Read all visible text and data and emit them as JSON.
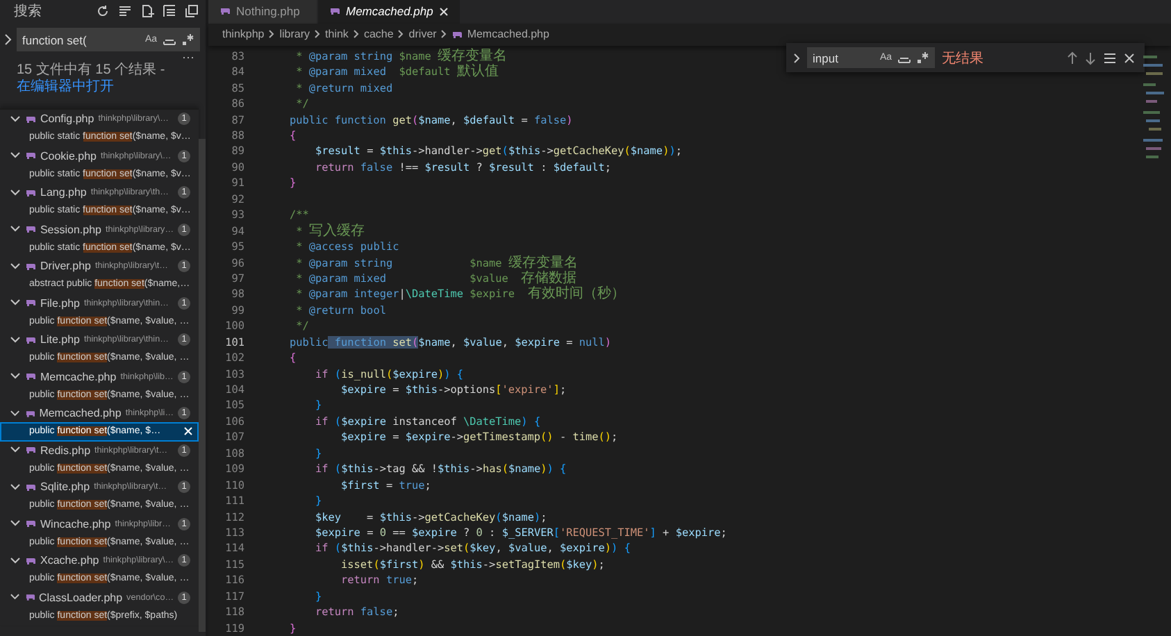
{
  "sidebar": {
    "title": "搜索",
    "search": {
      "value": "function set(",
      "case_label": "Aa"
    },
    "more": "···",
    "message": "15 文件中有 15 个结果 - ",
    "message_link": "在编辑器中打开",
    "results": [
      {
        "file": "Config.php",
        "path": "thinkphp\\library\\…",
        "count": "1",
        "expanded": true,
        "matches": [
          {
            "prefix": "public static ",
            "hit": "function set",
            "rest": "($name, $v…",
            "selected": false
          }
        ]
      },
      {
        "file": "Cookie.php",
        "path": "thinkphp\\library\\…",
        "count": "1",
        "expanded": true,
        "matches": [
          {
            "prefix": "public static ",
            "hit": "function set",
            "rest": "($name, $v…",
            "selected": false
          }
        ]
      },
      {
        "file": "Lang.php",
        "path": "thinkphp\\library\\th…",
        "count": "1",
        "expanded": true,
        "matches": [
          {
            "prefix": "public static ",
            "hit": "function set",
            "rest": "($name, $v…",
            "selected": false
          }
        ]
      },
      {
        "file": "Session.php",
        "path": "thinkphp\\library…",
        "count": "1",
        "expanded": true,
        "matches": [
          {
            "prefix": "public static ",
            "hit": "function set",
            "rest": "($name, $v…",
            "selected": false
          }
        ]
      },
      {
        "file": "Driver.php",
        "path": "thinkphp\\library\\t…",
        "count": "1",
        "expanded": true,
        "matches": [
          {
            "prefix": "abstract public ",
            "hit": "function set",
            "rest": "($name,…",
            "selected": false
          }
        ]
      },
      {
        "file": "File.php",
        "path": "thinkphp\\library\\thin…",
        "count": "1",
        "expanded": true,
        "matches": [
          {
            "prefix": "public ",
            "hit": "function set",
            "rest": "($name, $value, …",
            "selected": false
          }
        ]
      },
      {
        "file": "Lite.php",
        "path": "thinkphp\\library\\thin…",
        "count": "1",
        "expanded": true,
        "matches": [
          {
            "prefix": "public ",
            "hit": "function set",
            "rest": "($name, $value, …",
            "selected": false
          }
        ]
      },
      {
        "file": "Memcache.php",
        "path": "thinkphp\\lib…",
        "count": "1",
        "expanded": true,
        "matches": [
          {
            "prefix": "public ",
            "hit": "function set",
            "rest": "($name, $value, …",
            "selected": false
          }
        ]
      },
      {
        "file": "Memcached.php",
        "path": "thinkphp\\li…",
        "count": "1",
        "expanded": true,
        "matches": [
          {
            "prefix": "public ",
            "hit": "function set",
            "rest": "($name, $…",
            "selected": true
          }
        ]
      },
      {
        "file": "Redis.php",
        "path": "thinkphp\\library\\t…",
        "count": "1",
        "expanded": true,
        "matches": [
          {
            "prefix": "public ",
            "hit": "function set",
            "rest": "($name, $value, …",
            "selected": false
          }
        ]
      },
      {
        "file": "Sqlite.php",
        "path": "thinkphp\\library\\t…",
        "count": "1",
        "expanded": true,
        "matches": [
          {
            "prefix": "public ",
            "hit": "function set",
            "rest": "($name, $value, …",
            "selected": false
          }
        ]
      },
      {
        "file": "Wincache.php",
        "path": "thinkphp\\libr…",
        "count": "1",
        "expanded": true,
        "matches": [
          {
            "prefix": "public ",
            "hit": "function set",
            "rest": "($name, $value, …",
            "selected": false
          }
        ]
      },
      {
        "file": "Xcache.php",
        "path": "thinkphp\\library\\…",
        "count": "1",
        "expanded": true,
        "matches": [
          {
            "prefix": "public ",
            "hit": "function set",
            "rest": "($name, $value, …",
            "selected": false
          }
        ]
      },
      {
        "file": "ClassLoader.php",
        "path": "vendor\\co…",
        "count": "1",
        "expanded": true,
        "matches": [
          {
            "prefix": "public ",
            "hit": "function set",
            "rest": "($prefix, $paths)",
            "selected": false
          }
        ]
      }
    ]
  },
  "tabs": [
    {
      "label": "Nothing.php",
      "selected": false,
      "preview": false
    },
    {
      "label": "Memcached.php",
      "selected": true,
      "preview": true
    }
  ],
  "breadcrumb": [
    "thinkphp",
    "library",
    "think",
    "cache",
    "driver",
    "Memcached.php"
  ],
  "find": {
    "value": "input",
    "case_label": "Aa",
    "status": "无结果"
  },
  "code": [
    {
      "n": "83",
      "current": false,
      "tokens": [
        {
          "kind": "cm",
          "text": "     * "
        },
        {
          "kind": "tag",
          "text": "@param string"
        },
        {
          "kind": "cm",
          "text": " $name 缓存变量名"
        }
      ]
    },
    {
      "n": "84",
      "current": false,
      "tokens": [
        {
          "kind": "cm",
          "text": "     * "
        },
        {
          "kind": "tag",
          "text": "@param mixed"
        },
        {
          "kind": "cm",
          "text": "  $default 默认值"
        }
      ]
    },
    {
      "n": "85",
      "current": false,
      "tokens": [
        {
          "kind": "cm",
          "text": "     * "
        },
        {
          "kind": "tag",
          "text": "@return mixed"
        }
      ]
    },
    {
      "n": "86",
      "current": false,
      "tokens": [
        {
          "kind": "cm",
          "text": "     */"
        }
      ]
    },
    {
      "n": "87",
      "current": false,
      "tokens": [
        {
          "kind": "kw",
          "text": "    public function "
        },
        {
          "kind": "fn",
          "text": "get"
        },
        {
          "kind": "b2",
          "text": "("
        },
        {
          "kind": "var",
          "text": "$name"
        },
        {
          "kind": "op",
          "text": ", "
        },
        {
          "kind": "var",
          "text": "$default"
        },
        {
          "kind": "op",
          "text": " = "
        },
        {
          "kind": "kw",
          "text": "false"
        },
        {
          "kind": "b2",
          "text": ")"
        }
      ]
    },
    {
      "n": "88",
      "current": false,
      "tokens": [
        {
          "kind": "b2",
          "text": "    {"
        }
      ]
    },
    {
      "n": "89",
      "current": false,
      "tokens": [
        {
          "kind": "var",
          "text": "        $result"
        },
        {
          "kind": "op",
          "text": " = "
        },
        {
          "kind": "var",
          "text": "$this"
        },
        {
          "kind": "op",
          "text": "->handler->"
        },
        {
          "kind": "fn",
          "text": "get"
        },
        {
          "kind": "b3",
          "text": "("
        },
        {
          "kind": "var",
          "text": "$this"
        },
        {
          "kind": "op",
          "text": "->"
        },
        {
          "kind": "fn",
          "text": "getCacheKey"
        },
        {
          "kind": "b1",
          "text": "("
        },
        {
          "kind": "var",
          "text": "$name"
        },
        {
          "kind": "b1",
          "text": ")"
        },
        {
          "kind": "b3",
          "text": ")"
        },
        {
          "kind": "op",
          "text": ";"
        }
      ]
    },
    {
      "n": "90",
      "current": false,
      "tokens": [
        {
          "kind": "ctl",
          "text": "        return"
        },
        {
          "kind": "kw",
          "text": " false"
        },
        {
          "kind": "op",
          "text": " !== "
        },
        {
          "kind": "var",
          "text": "$result"
        },
        {
          "kind": "op",
          "text": " ? "
        },
        {
          "kind": "var",
          "text": "$result"
        },
        {
          "kind": "op",
          "text": " : "
        },
        {
          "kind": "var",
          "text": "$default"
        },
        {
          "kind": "op",
          "text": ";"
        }
      ]
    },
    {
      "n": "91",
      "current": false,
      "tokens": [
        {
          "kind": "b2",
          "text": "    }"
        }
      ]
    },
    {
      "n": "92",
      "current": false
    },
    {
      "n": "93",
      "current": false,
      "tokens": [
        {
          "kind": "cm",
          "text": "    /**"
        }
      ]
    },
    {
      "n": "94",
      "current": false,
      "tokens": [
        {
          "kind": "cm",
          "text": "     * 写入缓存"
        }
      ]
    },
    {
      "n": "95",
      "current": false,
      "tokens": [
        {
          "kind": "cm",
          "text": "     * "
        },
        {
          "kind": "tag",
          "text": "@access public"
        }
      ]
    },
    {
      "n": "96",
      "current": false,
      "tokens": [
        {
          "kind": "cm",
          "text": "     * "
        },
        {
          "kind": "tag",
          "text": "@param string"
        },
        {
          "kind": "cm",
          "text": "            $name 缓存变量名"
        }
      ]
    },
    {
      "n": "97",
      "current": false,
      "tokens": [
        {
          "kind": "cm",
          "text": "     * "
        },
        {
          "kind": "tag",
          "text": "@param mixed"
        },
        {
          "kind": "cm",
          "text": "             $value  存储数据"
        }
      ]
    },
    {
      "n": "98",
      "current": false,
      "tokens": [
        {
          "kind": "cm",
          "text": "     * "
        },
        {
          "kind": "tag",
          "text": "@param integer"
        },
        {
          "kind": "op",
          "text": "|"
        },
        {
          "kind": "cls",
          "text": "\\DateTime"
        },
        {
          "kind": "cm",
          "text": " $expire  有效时间（秒）"
        }
      ]
    },
    {
      "n": "99",
      "current": false,
      "tokens": [
        {
          "kind": "cm",
          "text": "     * "
        },
        {
          "kind": "tag",
          "text": "@return bool"
        }
      ]
    },
    {
      "n": "100",
      "current": false,
      "tokens": [
        {
          "kind": "cm",
          "text": "     */"
        }
      ]
    },
    {
      "n": "101",
      "current": true,
      "tokens": [
        {
          "kind": "kw",
          "text": "    public"
        },
        {
          "kind": "kw",
          "text": " function ",
          "match": true
        },
        {
          "kind": "fn",
          "text": "set",
          "match": true
        },
        {
          "kind": "b2",
          "text": "(",
          "match": true
        },
        {
          "kind": "var",
          "text": "$name"
        },
        {
          "kind": "op",
          "text": ", "
        },
        {
          "kind": "var",
          "text": "$value"
        },
        {
          "kind": "op",
          "text": ", "
        },
        {
          "kind": "var",
          "text": "$expire"
        },
        {
          "kind": "op",
          "text": " = "
        },
        {
          "kind": "kw",
          "text": "null"
        },
        {
          "kind": "b2",
          "text": ")"
        }
      ]
    },
    {
      "n": "102",
      "current": false,
      "tokens": [
        {
          "kind": "b2",
          "text": "    {"
        }
      ]
    },
    {
      "n": "103",
      "current": false,
      "tokens": [
        {
          "kind": "ctl",
          "text": "        if "
        },
        {
          "kind": "b3",
          "text": "("
        },
        {
          "kind": "fn",
          "text": "is_null"
        },
        {
          "kind": "b1",
          "text": "("
        },
        {
          "kind": "var",
          "text": "$expire"
        },
        {
          "kind": "b1",
          "text": ")"
        },
        {
          "kind": "b3",
          "text": ")"
        },
        {
          "kind": "b3",
          "text": " {"
        }
      ]
    },
    {
      "n": "104",
      "current": false,
      "tokens": [
        {
          "kind": "var",
          "text": "            $expire"
        },
        {
          "kind": "op",
          "text": " = "
        },
        {
          "kind": "var",
          "text": "$this"
        },
        {
          "kind": "op",
          "text": "->options"
        },
        {
          "kind": "b1",
          "text": "["
        },
        {
          "kind": "str",
          "text": "'expire'"
        },
        {
          "kind": "b1",
          "text": "]"
        },
        {
          "kind": "op",
          "text": ";"
        }
      ]
    },
    {
      "n": "105",
      "current": false,
      "tokens": [
        {
          "kind": "b3",
          "text": "        }"
        }
      ]
    },
    {
      "n": "106",
      "current": false,
      "tokens": [
        {
          "kind": "ctl",
          "text": "        if "
        },
        {
          "kind": "b3",
          "text": "("
        },
        {
          "kind": "var",
          "text": "$expire"
        },
        {
          "kind": "op",
          "text": " instanceof "
        },
        {
          "kind": "cls",
          "text": "\\DateTime"
        },
        {
          "kind": "b3",
          "text": ")"
        },
        {
          "kind": "b3",
          "text": " {"
        }
      ]
    },
    {
      "n": "107",
      "current": false,
      "tokens": [
        {
          "kind": "var",
          "text": "            $expire"
        },
        {
          "kind": "op",
          "text": " = "
        },
        {
          "kind": "var",
          "text": "$expire"
        },
        {
          "kind": "op",
          "text": "->"
        },
        {
          "kind": "fn",
          "text": "getTimestamp"
        },
        {
          "kind": "b1",
          "text": "()"
        },
        {
          "kind": "op",
          "text": " - "
        },
        {
          "kind": "fn",
          "text": "time"
        },
        {
          "kind": "b1",
          "text": "()"
        },
        {
          "kind": "op",
          "text": ";"
        }
      ]
    },
    {
      "n": "108",
      "current": false,
      "tokens": [
        {
          "kind": "b3",
          "text": "        }"
        }
      ]
    },
    {
      "n": "109",
      "current": false,
      "tokens": [
        {
          "kind": "ctl",
          "text": "        if "
        },
        {
          "kind": "b3",
          "text": "("
        },
        {
          "kind": "var",
          "text": "$this"
        },
        {
          "kind": "op",
          "text": "->tag && !"
        },
        {
          "kind": "var",
          "text": "$this"
        },
        {
          "kind": "op",
          "text": "->"
        },
        {
          "kind": "fn",
          "text": "has"
        },
        {
          "kind": "b1",
          "text": "("
        },
        {
          "kind": "var",
          "text": "$name"
        },
        {
          "kind": "b1",
          "text": ")"
        },
        {
          "kind": "b3",
          "text": ")"
        },
        {
          "kind": "b3",
          "text": " {"
        }
      ]
    },
    {
      "n": "110",
      "current": false,
      "tokens": [
        {
          "kind": "var",
          "text": "            $first"
        },
        {
          "kind": "op",
          "text": " = "
        },
        {
          "kind": "kw",
          "text": "true"
        },
        {
          "kind": "op",
          "text": ";"
        }
      ]
    },
    {
      "n": "111",
      "current": false,
      "tokens": [
        {
          "kind": "b3",
          "text": "        }"
        }
      ]
    },
    {
      "n": "112",
      "current": false,
      "tokens": [
        {
          "kind": "var",
          "text": "        $key"
        },
        {
          "kind": "op",
          "text": "    = "
        },
        {
          "kind": "var",
          "text": "$this"
        },
        {
          "kind": "op",
          "text": "->"
        },
        {
          "kind": "fn",
          "text": "getCacheKey"
        },
        {
          "kind": "b3",
          "text": "("
        },
        {
          "kind": "var",
          "text": "$name"
        },
        {
          "kind": "b3",
          "text": ")"
        },
        {
          "kind": "op",
          "text": ";"
        }
      ]
    },
    {
      "n": "113",
      "current": false,
      "tokens": [
        {
          "kind": "var",
          "text": "        $expire"
        },
        {
          "kind": "op",
          "text": " = "
        },
        {
          "kind": "num",
          "text": "0"
        },
        {
          "kind": "op",
          "text": " == "
        },
        {
          "kind": "var",
          "text": "$expire"
        },
        {
          "kind": "op",
          "text": " ? "
        },
        {
          "kind": "num",
          "text": "0"
        },
        {
          "kind": "op",
          "text": " : "
        },
        {
          "kind": "var",
          "text": "$_SERVER"
        },
        {
          "kind": "b3",
          "text": "["
        },
        {
          "kind": "str",
          "text": "'REQUEST_TIME'"
        },
        {
          "kind": "b3",
          "text": "]"
        },
        {
          "kind": "op",
          "text": " + "
        },
        {
          "kind": "var",
          "text": "$expire"
        },
        {
          "kind": "op",
          "text": ";"
        }
      ]
    },
    {
      "n": "114",
      "current": false,
      "tokens": [
        {
          "kind": "ctl",
          "text": "        if "
        },
        {
          "kind": "b3",
          "text": "("
        },
        {
          "kind": "var",
          "text": "$this"
        },
        {
          "kind": "op",
          "text": "->handler->"
        },
        {
          "kind": "fn",
          "text": "set"
        },
        {
          "kind": "b1",
          "text": "("
        },
        {
          "kind": "var",
          "text": "$key"
        },
        {
          "kind": "op",
          "text": ", "
        },
        {
          "kind": "var",
          "text": "$value"
        },
        {
          "kind": "op",
          "text": ", "
        },
        {
          "kind": "var",
          "text": "$expire"
        },
        {
          "kind": "b1",
          "text": ")"
        },
        {
          "kind": "b3",
          "text": ")"
        },
        {
          "kind": "b3",
          "text": " {"
        }
      ]
    },
    {
      "n": "115",
      "current": false,
      "tokens": [
        {
          "kind": "fn",
          "text": "            isset"
        },
        {
          "kind": "b1",
          "text": "("
        },
        {
          "kind": "var",
          "text": "$first"
        },
        {
          "kind": "b1",
          "text": ")"
        },
        {
          "kind": "op",
          "text": " && "
        },
        {
          "kind": "var",
          "text": "$this"
        },
        {
          "kind": "op",
          "text": "->"
        },
        {
          "kind": "fn",
          "text": "setTagItem"
        },
        {
          "kind": "b1",
          "text": "("
        },
        {
          "kind": "var",
          "text": "$key"
        },
        {
          "kind": "b1",
          "text": ")"
        },
        {
          "kind": "op",
          "text": ";"
        }
      ]
    },
    {
      "n": "116",
      "current": false,
      "tokens": [
        {
          "kind": "ctl",
          "text": "            return"
        },
        {
          "kind": "kw",
          "text": " true"
        },
        {
          "kind": "op",
          "text": ";"
        }
      ]
    },
    {
      "n": "117",
      "current": false,
      "tokens": [
        {
          "kind": "b3",
          "text": "        }"
        }
      ]
    },
    {
      "n": "118",
      "current": false,
      "tokens": [
        {
          "kind": "ctl",
          "text": "        return"
        },
        {
          "kind": "kw",
          "text": " false"
        },
        {
          "kind": "op",
          "text": ";"
        }
      ]
    },
    {
      "n": "119",
      "current": false,
      "tokens": [
        {
          "kind": "b2",
          "text": "    }"
        }
      ]
    }
  ]
}
